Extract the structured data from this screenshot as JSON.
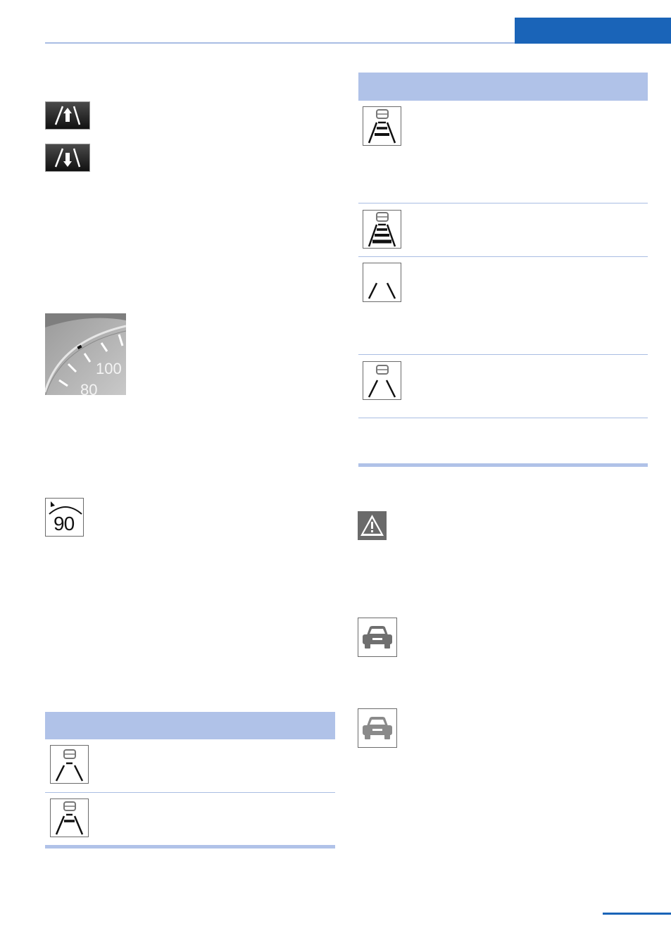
{
  "colors": {
    "accent": "#1a64b8",
    "table_header": "#b0c2e8",
    "rule": "#a9bde3"
  },
  "icons": {
    "left_column": [
      "lane-keeping-on-icon",
      "lane-keeping-off-icon",
      "speedometer-marker-image",
      "speed-limit-90-icon"
    ],
    "table_left": [
      "lane-car-ahead-icon",
      "lane-car-ahead-marked-icon"
    ],
    "table_right": [
      "lane-car-distance-3-icon",
      "lane-car-distance-4-icon",
      "lane-lines-only-icon",
      "lane-car-no-marks-icon"
    ],
    "right_bottom": [
      "warning-triangle-icon",
      "vehicle-detected-icon",
      "vehicle-gray-icon"
    ]
  },
  "speedometer": {
    "label_100": "100",
    "label_80": "80"
  },
  "speed_limit_icon": {
    "value": "90"
  }
}
